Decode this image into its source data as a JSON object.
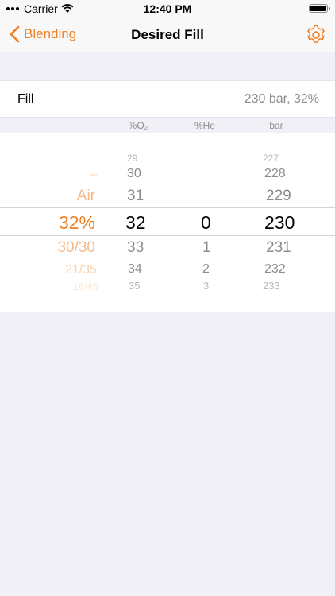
{
  "status": {
    "carrier": "Carrier",
    "time": "12:40 PM"
  },
  "nav": {
    "back_label": "Blending",
    "title": "Desired Fill"
  },
  "fill": {
    "label": "Fill",
    "value": "230 bar, 32%"
  },
  "columns": {
    "o2": "%O₂",
    "he": "%He",
    "bar": "bar"
  },
  "picker": {
    "mix": {
      "above2": "–",
      "above1": "Air",
      "selected": "32%",
      "below1": "30/30",
      "below2": "21/35",
      "below3": "18/45"
    },
    "o2": {
      "above3": "29",
      "above2": "30",
      "above1": "31",
      "selected": "32",
      "below1": "33",
      "below2": "34",
      "below3": "35"
    },
    "he": {
      "selected": "0",
      "below1": "1",
      "below2": "2",
      "below3": "3"
    },
    "bar": {
      "above3": "227",
      "above2": "228",
      "above1": "229",
      "selected": "230",
      "below1": "231",
      "below2": "232",
      "below3": "233"
    }
  },
  "colors": {
    "accent": "#ef7f22",
    "secondary_text": "#8c8c90",
    "background": "#f1f0f6"
  },
  "icons": {
    "back": "chevron-left-icon",
    "settings": "gear-icon",
    "wifi": "wifi-icon",
    "battery": "battery-icon"
  }
}
